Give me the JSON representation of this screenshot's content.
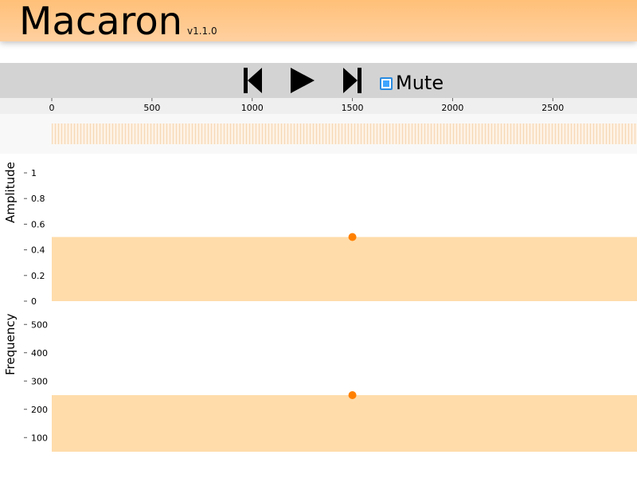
{
  "header": {
    "title": "Macaron",
    "version": "v1.1.0"
  },
  "transport": {
    "icons": [
      "skip-back-icon",
      "play-icon",
      "skip-forward-icon"
    ],
    "mute_label": "Mute",
    "mute_checked": false
  },
  "timeline": {
    "ticks": [
      "0",
      "500",
      "1000",
      "1500",
      "2000",
      "2500"
    ],
    "tick_values": [
      0,
      500,
      1000,
      1500,
      2000,
      2500
    ],
    "domain": [
      0,
      2920
    ]
  },
  "colors": {
    "header": "#ffc078",
    "fill": "#ffdcaa",
    "point": "#ff8000",
    "overview": "#f6d6b2"
  },
  "chart_data": [
    {
      "type": "area",
      "ylabel": "Amplitude",
      "yticks": [
        "0",
        "0.2",
        "0.4",
        "0.6",
        "0.8",
        "1"
      ],
      "ytick_values": [
        0,
        0.2,
        0.4,
        0.6,
        0.8,
        1
      ],
      "ylim": [
        0,
        1
      ],
      "xlim": [
        0,
        2920
      ],
      "points": [
        {
          "x": 1500,
          "y": 0.5
        }
      ]
    },
    {
      "type": "area",
      "ylabel": "Frequency",
      "yticks": [
        "100",
        "200",
        "300",
        "400",
        "500"
      ],
      "ytick_values": [
        100,
        200,
        300,
        400,
        500
      ],
      "ylim": [
        50,
        550
      ],
      "xlim": [
        0,
        2920
      ],
      "points": [
        {
          "x": 1500,
          "y": 250
        }
      ]
    }
  ]
}
